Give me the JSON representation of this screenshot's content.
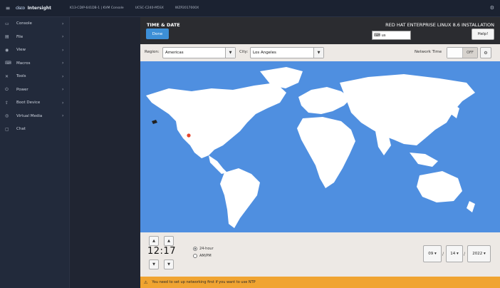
{
  "topbar": {
    "logo_text": "cisco",
    "brand": "Intersight",
    "crumbs": [
      "K13-CDIP-641DB-1 | KVM Console",
      "UCSC-C240-M5SX",
      "WZP2017000X"
    ]
  },
  "sidebar": {
    "items": [
      {
        "label": "Console",
        "icon": "monitor-icon",
        "glyph": "▭",
        "chevron": true
      },
      {
        "label": "File",
        "icon": "file-icon",
        "glyph": "▤",
        "chevron": true
      },
      {
        "label": "View",
        "icon": "eye-icon",
        "glyph": "◉",
        "chevron": true
      },
      {
        "label": "Macros",
        "icon": "keyboard-icon",
        "glyph": "⌨",
        "chevron": true
      },
      {
        "label": "Tools",
        "icon": "tools-icon",
        "glyph": "✕",
        "chevron": true
      },
      {
        "label": "Power",
        "icon": "power-icon",
        "glyph": "⏻",
        "chevron": true
      },
      {
        "label": "Boot Device",
        "icon": "boot-icon",
        "glyph": "⇪",
        "chevron": true
      },
      {
        "label": "Virtual Media",
        "icon": "disc-icon",
        "glyph": "◎",
        "chevron": true
      },
      {
        "label": "Chat",
        "icon": "chat-icon",
        "glyph": "▢",
        "chevron": false
      }
    ]
  },
  "installer": {
    "title": "TIME & DATE",
    "done_label": "Done",
    "product_title": "RED HAT ENTERPRISE LINUX 8.6 INSTALLATION",
    "keyboard_layout": "us",
    "help_label": "Help!",
    "region_label": "Region:",
    "region_value": "Americas",
    "city_label": "City:",
    "city_value": "Los Angeles",
    "network_time_label": "Network Time",
    "ntp_state": "OFF",
    "time": "12:17",
    "format_24h": "24-hour",
    "format_ampm": "AM/PM",
    "month": "09",
    "day": "14",
    "year": "2022",
    "warning": "You need to set up networking first if you want to use NTP"
  },
  "colors": {
    "map_ocean": "#4f8fe0",
    "done_button": "#3d8fd6",
    "warning_bar": "#f0a431",
    "selected_city": "#e8462e"
  }
}
